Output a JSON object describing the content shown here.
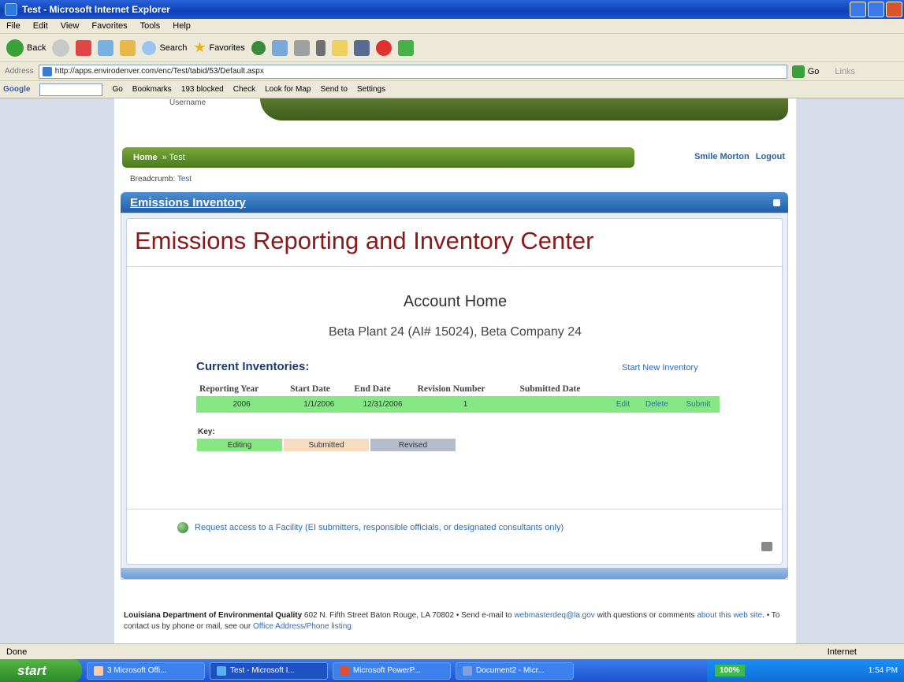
{
  "window": {
    "title": "Test - Microsoft Internet Explorer"
  },
  "menu": [
    "File",
    "Edit",
    "View",
    "Favorites",
    "Tools",
    "Help"
  ],
  "toolbar": {
    "back": "Back",
    "search": "Search",
    "favorites": "Favorites"
  },
  "address": {
    "label": "Address",
    "url": "http://apps.envirodenver.com/enc/Test/tabid/53/Default.aspx",
    "go": "Go",
    "links": "Links"
  },
  "google_bar": {
    "label": "Google",
    "go": "Go",
    "bookmarks": "Bookmarks",
    "blocked": "193 blocked",
    "check": "Check",
    "lookup": "Look for Map",
    "send": "Send to",
    "settings": "Settings"
  },
  "site": {
    "account_dropdown": "Username",
    "nav": {
      "home": "Home",
      "current": "» Test"
    },
    "user": {
      "name": "Smile Morton",
      "logout": "Logout"
    },
    "breadcrumb": {
      "label": "Breadcrumb:",
      "item": "Test"
    },
    "panel_title": "Emissions Inventory",
    "heading": "Emissions Reporting and Inventory Center",
    "subheading": "Account Home",
    "facility": "Beta Plant 24 (AI# 15024), Beta Company 24",
    "inventories": {
      "title": "Current Inventories:",
      "start_new": "Start New Inventory",
      "columns": [
        "Reporting Year",
        "Start Date",
        "End Date",
        "Revision Number",
        "Submitted Date"
      ],
      "rows": [
        {
          "year": "2006",
          "start": "1/1/2006",
          "end": "12/31/2006",
          "revision": "1",
          "submitted": "",
          "edit": "Edit",
          "delete": "Delete",
          "submit": "Submit"
        }
      ]
    },
    "key": {
      "label": "Key:",
      "items": [
        {
          "label": "Editing",
          "color": "#86e884"
        },
        {
          "label": "Submitted",
          "color": "#f8dcc0"
        },
        {
          "label": "Revised",
          "color": "#b4bccb"
        }
      ]
    },
    "request_access": "Request access to a Facility (EI submitters, responsible officials, or designated consultants only)",
    "footer": {
      "org": "Louisiana Department of Environmental Quality",
      "address": " 602 N. Fifth Street Baton Rouge, LA 70802 • Send e-mail to ",
      "email": "webmasterdeq@la.gov",
      "with": " with questions or comments ",
      "about": "about this web site",
      "contact": ". • To contact us by phone or mail, see our ",
      "office": "Office Address/Phone listing"
    }
  },
  "status": {
    "left": "Done",
    "right": "Internet"
  },
  "taskbar": {
    "start": "start",
    "tasks": [
      "3 Microsoft Offi...",
      "Test - Microsoft I...",
      "Microsoft PowerP...",
      "Document2 - Micr..."
    ],
    "zoom": "100%",
    "time": "1:54 PM"
  }
}
